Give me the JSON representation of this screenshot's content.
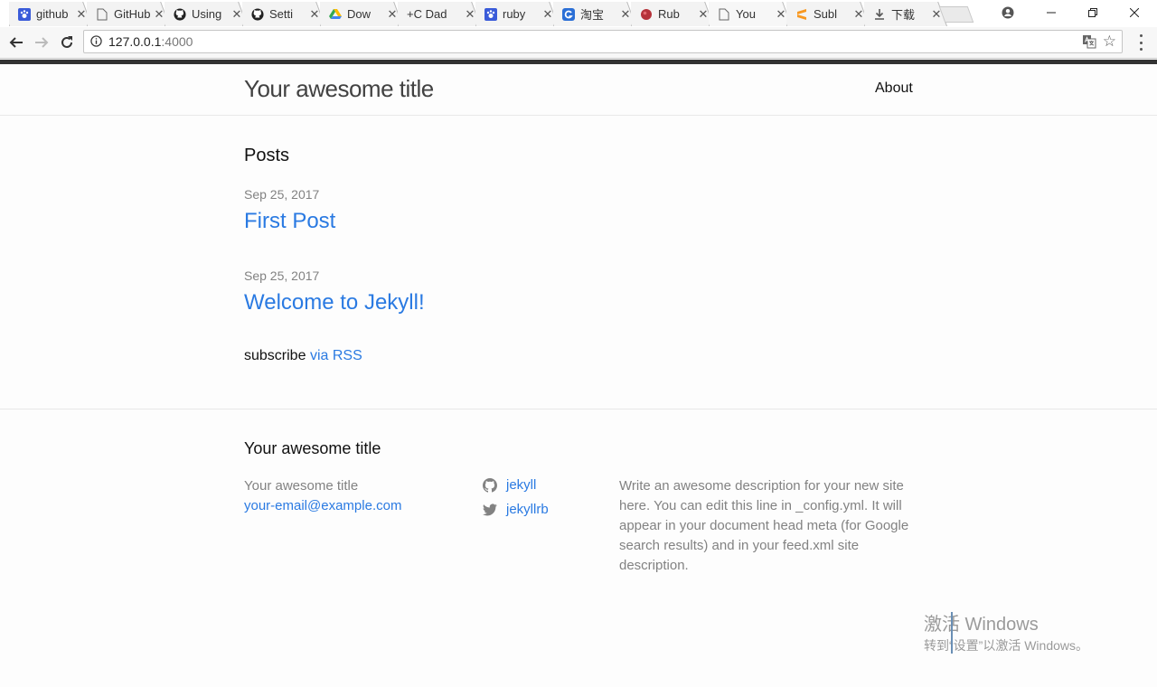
{
  "browser": {
    "tabs": [
      {
        "favicon": "baidu-paw-icon",
        "title": "github",
        "active": false
      },
      {
        "favicon": "page-icon",
        "title": "GitHub",
        "active": false
      },
      {
        "favicon": "github-icon",
        "title": "Using",
        "active": false
      },
      {
        "favicon": "github-icon",
        "title": "Setti",
        "active": false
      },
      {
        "favicon": "google-drive-icon",
        "title": "Dow",
        "active": false
      },
      {
        "favicon": "plus-c-icon",
        "title": "+C Dad",
        "active": false
      },
      {
        "favicon": "baidu-paw-icon",
        "title": "ruby",
        "active": false
      },
      {
        "favicon": "g-icon",
        "title": "淘宝",
        "active": false
      },
      {
        "favicon": "ruby-icon",
        "title": "Rub",
        "active": false
      },
      {
        "favicon": "page-icon",
        "title": "You",
        "active": true
      },
      {
        "favicon": "sublime-icon",
        "title": "Subl",
        "active": false
      },
      {
        "favicon": "download-icon",
        "title": "下载",
        "active": false
      }
    ],
    "address": {
      "host": "127.0.0.1",
      "port": ":4000"
    }
  },
  "site": {
    "title": "Your awesome title",
    "nav": {
      "about": "About"
    }
  },
  "main": {
    "heading": "Posts",
    "posts": [
      {
        "date": "Sep 25, 2017",
        "title": "First Post"
      },
      {
        "date": "Sep 25, 2017",
        "title": "Welcome to Jekyll!"
      }
    ],
    "rss": {
      "prefix": "subscribe",
      "link": "via RSS"
    }
  },
  "footer": {
    "heading": "Your awesome title",
    "name": "Your awesome title",
    "email": "your-email@example.com",
    "github": "jekyll",
    "twitter": "jekyllrb",
    "description": "Write an awesome description for your new site here. You can edit this line in _config.yml. It will appear in your document head meta (for Google search results) and in your feed.xml site description."
  },
  "watermark": {
    "line1": "激活 Windows",
    "line2": "转到“设置”以激活 Windows。"
  },
  "colors": {
    "link": "#2a7ae2",
    "muted": "#828282",
    "topbar": "#333333"
  }
}
